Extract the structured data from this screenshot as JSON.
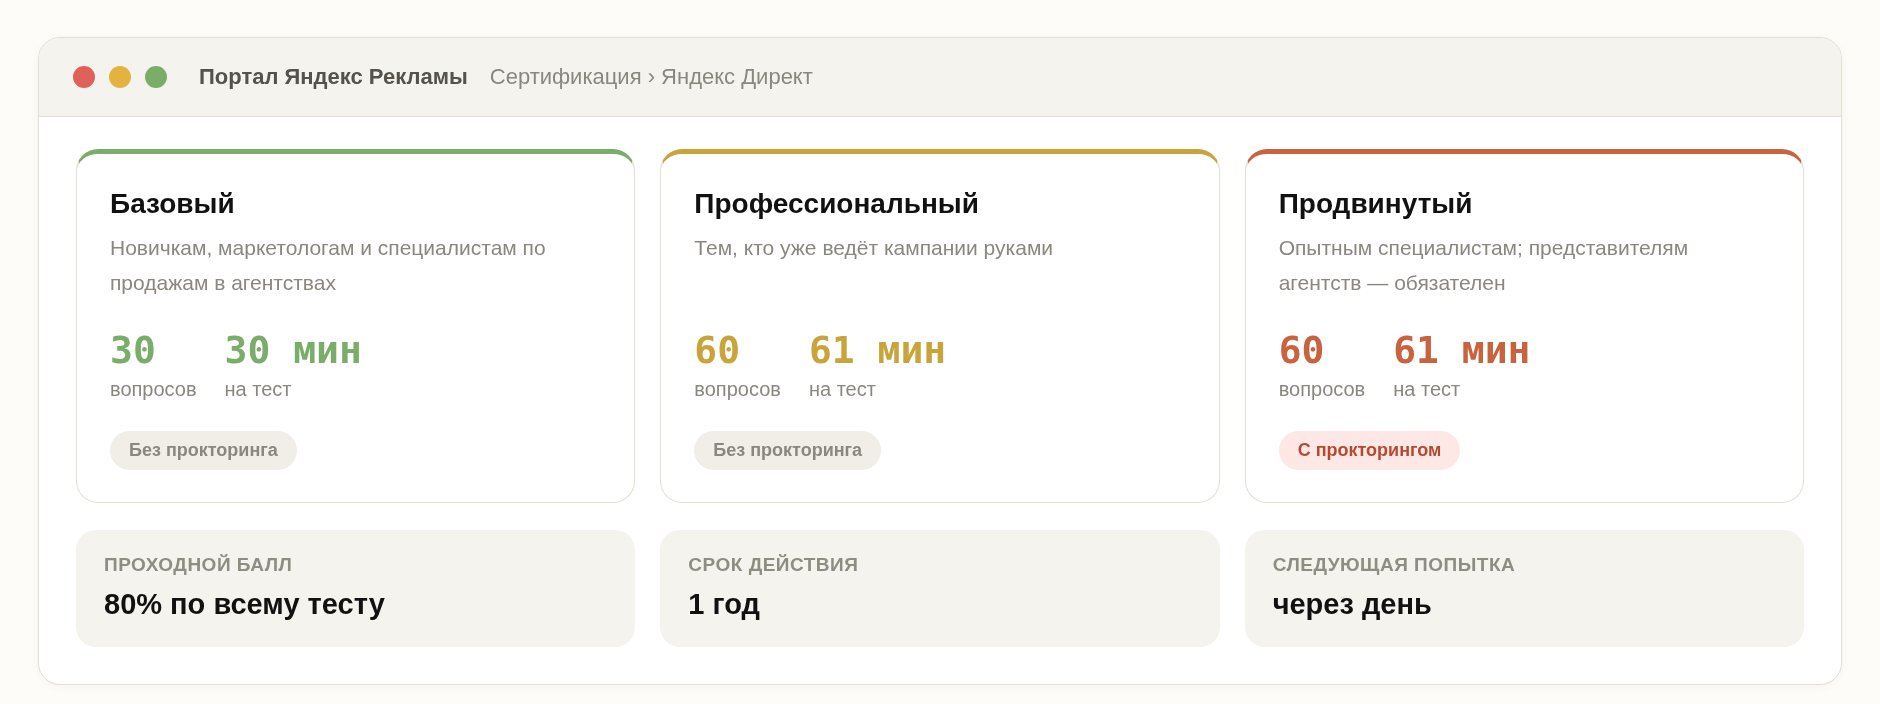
{
  "window": {
    "title": "Портал Яндекс Рекламы",
    "breadcrumb": "Сертификация › Яндекс Директ"
  },
  "levels": [
    {
      "title": "Базовый",
      "description": "Новичкам, маркетологам и специалистам по продажам в агентствах",
      "color": "#7aad6a",
      "questions": "30",
      "questions_label": "вопросов",
      "duration": "30 мин",
      "duration_label": "на тест",
      "badge": "Без прокторинга",
      "proctored": false
    },
    {
      "title": "Профессиональный",
      "description": "Тем, кто уже ведёт кампании руками",
      "color": "#c9a43a",
      "questions": "60",
      "questions_label": "вопросов",
      "duration": "61 мин",
      "duration_label": "на тест",
      "badge": "Без прокторинга",
      "proctored": false
    },
    {
      "title": "Продвинутый",
      "description": "Опытным специалистам; представителям агентств — обязателен",
      "color": "#c8623f",
      "questions": "60",
      "questions_label": "вопросов",
      "duration": "61 мин",
      "duration_label": "на тест",
      "badge": "С прокторингом",
      "proctored": true
    }
  ],
  "facts": [
    {
      "label": "ПРОХОДНОЙ БАЛЛ",
      "value": "80% по всему тесту"
    },
    {
      "label": "СРОК ДЕЙСТВИЯ",
      "value": "1 год"
    },
    {
      "label": "СЛЕДУЮЩАЯ ПОПЫТКА",
      "value": "через день"
    }
  ]
}
